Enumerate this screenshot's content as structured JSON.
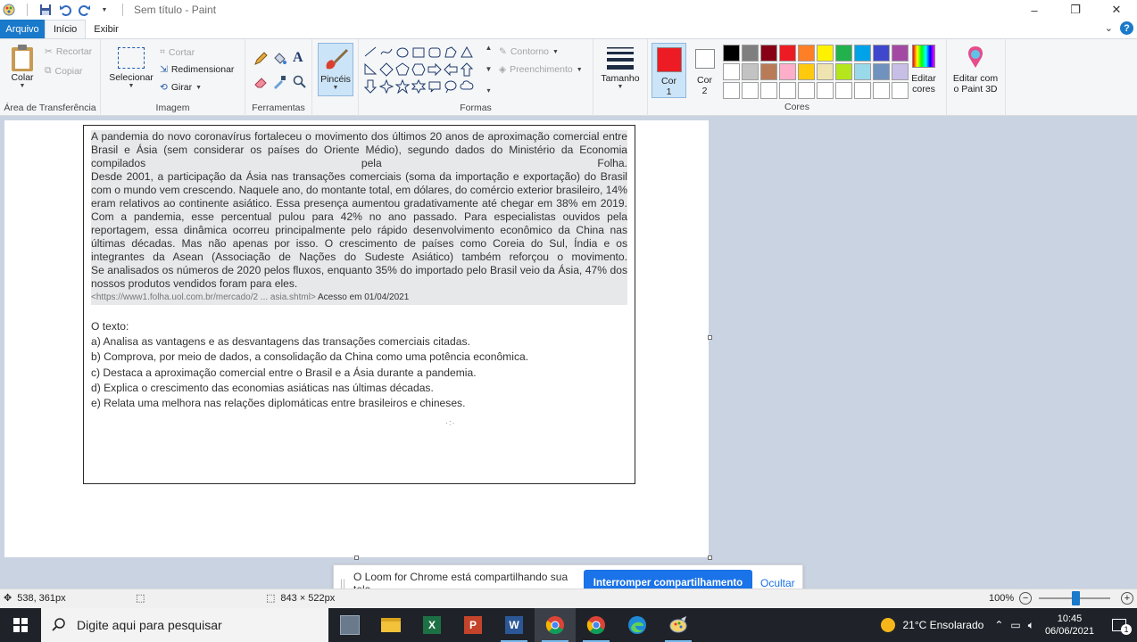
{
  "window": {
    "title": "Sem título - Paint",
    "controls": {
      "minimize": "–",
      "maximize": "❐",
      "close": "✕"
    }
  },
  "tabs": {
    "file": "Arquivo",
    "home": "Início",
    "view": "Exibir"
  },
  "ribbon": {
    "clipboard": {
      "label": "Área de Transferência",
      "paste": "Colar",
      "cut": "Recortar",
      "copy": "Copiar"
    },
    "image": {
      "label": "Imagem",
      "select": "Selecionar",
      "crop": "Cortar",
      "resize": "Redimensionar",
      "rotate": "Girar"
    },
    "tools": {
      "label": "Ferramentas"
    },
    "brushes": {
      "label": "Pincéis"
    },
    "shapes": {
      "label": "Formas",
      "outline": "Contorno",
      "fill": "Preenchimento"
    },
    "size": {
      "label": "Tamanho"
    },
    "color1": {
      "label": "Cor",
      "num": "1"
    },
    "color2": {
      "label": "Cor",
      "num": "2"
    },
    "colors": {
      "label": "Cores",
      "edit_line1": "Editar",
      "edit_line2": "cores"
    },
    "paint3d": {
      "line1": "Editar com",
      "line2": "o Paint 3D"
    }
  },
  "colors": {
    "accent": "#1979ca",
    "color1": "#ed1c24",
    "color2": "#ffffff",
    "palette_row1": [
      "#000000",
      "#7f7f7f",
      "#880015",
      "#ed1c24",
      "#ff7f27",
      "#fff200",
      "#22b14c",
      "#00a2e8",
      "#3f48cc",
      "#a349a4"
    ],
    "palette_row2": [
      "#ffffff",
      "#c3c3c3",
      "#b97a57",
      "#ffaec9",
      "#ffc90e",
      "#efe4b0",
      "#b5e61d",
      "#99d9ea",
      "#7092be",
      "#c8bfe7"
    ]
  },
  "document": {
    "quote_paragraphs": [
      "A pandemia do novo coronavírus fortaleceu o movimento dos últimos 20 anos de aproximação comercial entre Brasil e Ásia (sem considerar os países do Oriente Médio), segundo dados do Ministério da Economia compilados pela Folha.",
      "Desde 2001, a participação da Ásia nas transações comerciais (soma da importação e exportação) do Brasil com o mundo vem crescendo. Naquele ano, do montante total, em dólares, do comércio exterior brasileiro, 14% eram relativos ao continente asiático. Essa presença aumentou gradativamente até chegar em 38% em 2019. Com a pandemia, esse percentual pulou para 42% no ano passado. Para especialistas ouvidos pela reportagem, essa dinâmica ocorreu principalmente pelo rápido desenvolvimento econômico da China nas últimas décadas. Mas não apenas por isso. O crescimento de países como Coreia do Sul, Índia e os integrantes da Asean (Associação de Nações do Sudeste Asiático) também reforçou o movimento.",
      "Se analisados os números de 2020 pelos fluxos, enquanto 35% do importado pelo Brasil veio da Ásia, 47% dos nossos produtos vendidos foram para eles."
    ],
    "source_url": "<https://www1.folha.uol.com.br/mercado/2 ... asia.shtml>",
    "source_access": " Acesso em 01/04/2021",
    "question_stem": "O texto:",
    "options": [
      "a) Analisa as vantagens e as desvantagens das transações comerciais citadas.",
      "b) Comprova, por meio de dados, a consolidação da China como uma potência econômica.",
      "c) Destaca a aproximação comercial entre o Brasil e a Ásia durante a pandemia.",
      "d) Explica o crescimento das economias asiáticas nas últimas décadas.",
      "e) Relata uma melhora nas relações diplomáticas entre brasileiros e chineses."
    ]
  },
  "loom": {
    "message": "O Loom for Chrome está compartilhando sua tela.",
    "stop_button": "Interromper compartilhamento",
    "hide_button": "Ocultar"
  },
  "statusbar": {
    "cursor_pos": "538, 361px",
    "canvas_size": "843 × 522px",
    "zoom": "100%",
    "zoom_level": 0.5
  },
  "taskbar": {
    "search_placeholder": "Digite aqui para pesquisar",
    "weather": "21°C  Ensolarado",
    "time": "10:45",
    "date": "06/06/2021",
    "notification_count": "1"
  }
}
